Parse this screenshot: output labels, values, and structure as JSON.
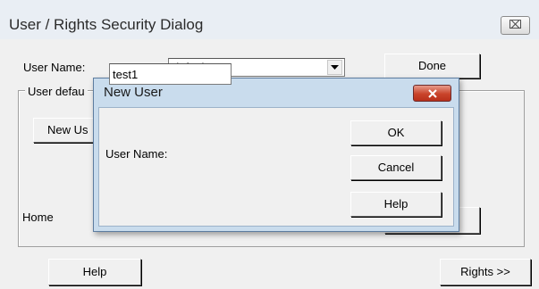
{
  "outer_dialog": {
    "title": "User / Rights Security Dialog",
    "close_glyph": "⌧",
    "user_name_label": "User Name:",
    "user_name_value": "default",
    "done_label": "Done",
    "group_label": "User defau",
    "new_user_button_label": "New Us",
    "home_label": "Home",
    "help_label": "Help",
    "rights_label": "Rights >>"
  },
  "new_user_dialog": {
    "title": "New User",
    "user_name_label": "User Name:",
    "user_name_value": "test1",
    "ok_label": "OK",
    "cancel_label": "Cancel",
    "help_label": "Help"
  },
  "icons": [
    "close-icon",
    "dropdown-arrow-icon",
    "close-red-icon"
  ],
  "colors": {
    "dialog_background": "#f0f0f0",
    "title_bar": "#e9eef4",
    "inner_frame": "#c9dced",
    "close_button_red": "#c9442a"
  }
}
